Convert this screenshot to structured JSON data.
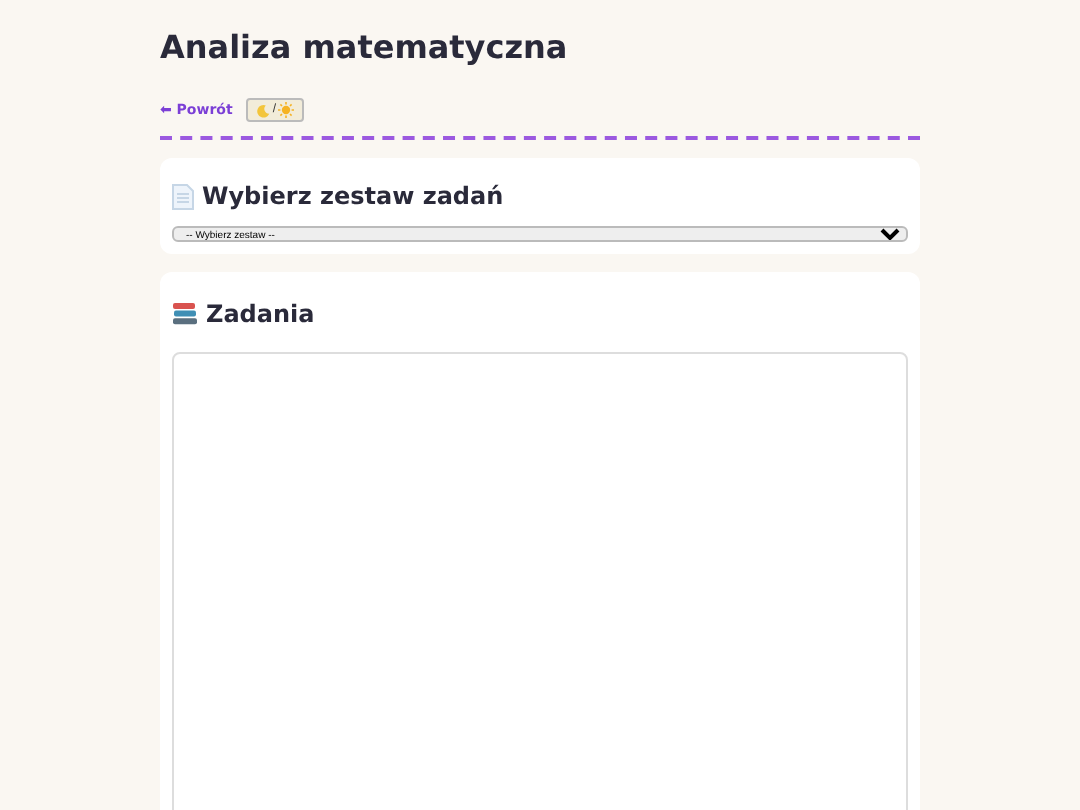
{
  "title": "Analiza matematyczna",
  "nav": {
    "back_link": "⬅ Powrót",
    "theme_toggle": "/"
  },
  "set_picker": {
    "heading": "Wybierz zestaw zadań",
    "select_value": "-- Wybierz zestaw --"
  },
  "tasks": {
    "heading": "Zadania"
  }
}
